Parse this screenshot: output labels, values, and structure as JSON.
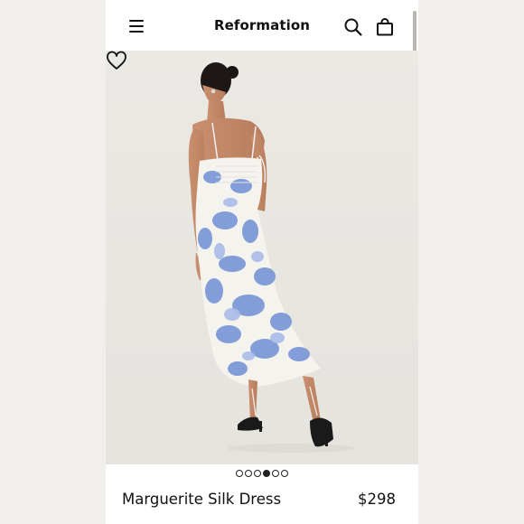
{
  "header": {
    "brand": "Reformation",
    "icons": [
      "menu-icon",
      "search-icon",
      "bag-icon"
    ]
  },
  "product": {
    "name": "Marguerite Silk Dress",
    "price": "$298",
    "image_description": "model in blue and white floral print silk slip dress",
    "wishlist_icon": "heart-icon"
  },
  "carousel": {
    "total_images": 6,
    "active_index": 3
  },
  "colors": {
    "background": "#ffffff",
    "text": "#111111",
    "print_blue": "#6f8fd3"
  }
}
